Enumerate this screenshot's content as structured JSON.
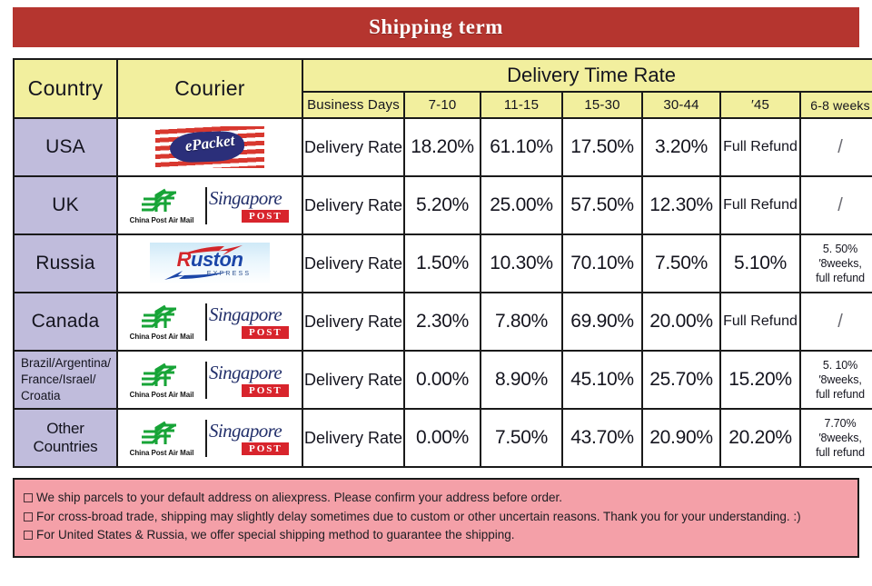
{
  "banner": {
    "title": "Shipping term"
  },
  "table": {
    "headers": {
      "country": "Country",
      "courier": "Courier",
      "delivery_time_rate": "Delivery Time Rate",
      "business_days": "Business Days",
      "d7_10": "7-10",
      "d11_15": "11-15",
      "d15_30": "15-30",
      "d30_44": "30-44",
      "d45": "′45",
      "weeks_6_8": "6-8 weeks"
    },
    "rows": [
      {
        "country": "USA",
        "couriers": [
          "epacket"
        ],
        "rate_label": "Delivery Rate",
        "d7_10": "18.20%",
        "d11_15": "61.10%",
        "d15_30": "17.50%",
        "d30_44": "3.20%",
        "d45": "Full Refund",
        "weeks_6_8": "/"
      },
      {
        "country": "UK",
        "couriers": [
          "china-post",
          "singapore-post"
        ],
        "rate_label": "Delivery Rate",
        "d7_10": "5.20%",
        "d11_15": "25.00%",
        "d15_30": "57.50%",
        "d30_44": "12.30%",
        "d45": "Full Refund",
        "weeks_6_8": "/"
      },
      {
        "country": "Russia",
        "couriers": [
          "ruston"
        ],
        "rate_label": "Delivery Rate",
        "d7_10": "1.50%",
        "d11_15": "10.30%",
        "d15_30": "70.10%",
        "d30_44": "7.50%",
        "d45": "5.10%",
        "weeks_6_8": "5. 50%\n′8weeks,\nfull refund"
      },
      {
        "country": "Canada",
        "couriers": [
          "china-post",
          "singapore-post"
        ],
        "rate_label": "Delivery Rate",
        "d7_10": "2.30%",
        "d11_15": "7.80%",
        "d15_30": "69.90%",
        "d30_44": "20.00%",
        "d45": "Full Refund",
        "weeks_6_8": "/"
      },
      {
        "country": "Brazil/Argentina/\nFrance/Israel/\nCroatia",
        "couriers": [
          "china-post",
          "singapore-post"
        ],
        "rate_label": "Delivery Rate",
        "d7_10": "0.00%",
        "d11_15": "8.90%",
        "d15_30": "45.10%",
        "d30_44": "25.70%",
        "d45": "15.20%",
        "weeks_6_8": "5. 10%\n′8weeks,\nfull refund"
      },
      {
        "country": "Other Countries",
        "couriers": [
          "china-post",
          "singapore-post"
        ],
        "rate_label": "Delivery Rate",
        "d7_10": "0.00%",
        "d11_15": "7.50%",
        "d15_30": "43.70%",
        "d30_44": "20.90%",
        "d45": "20.20%",
        "weeks_6_8": "7.70%\n′8weeks,\nfull  refund"
      }
    ]
  },
  "logos": {
    "epacket": {
      "text": "ePacket"
    },
    "china_post": {
      "caption": "China Post Air Mail"
    },
    "singapore_post": {
      "script": "Singapore",
      "box": "POST"
    },
    "ruston": {
      "k": "R",
      "rest": "uston",
      "sub": "EXPRESS"
    }
  },
  "notes": [
    "We ship parcels to your default address on aliexpress. Please confirm your address before order.",
    "For cross-broad trade, shipping may slightly delay sometimes due to custom or other uncertain reasons. Thank you for your understanding. :)",
    "For United States & Russia, we offer special shipping method to guarantee the shipping."
  ],
  "colors": {
    "banner_red": "#b5352f",
    "header_yellow": "#f2ef9e",
    "country_lavender": "#c0bcdc",
    "notes_pink": "#f4a0a8",
    "border_black": "#1a1a1a"
  }
}
